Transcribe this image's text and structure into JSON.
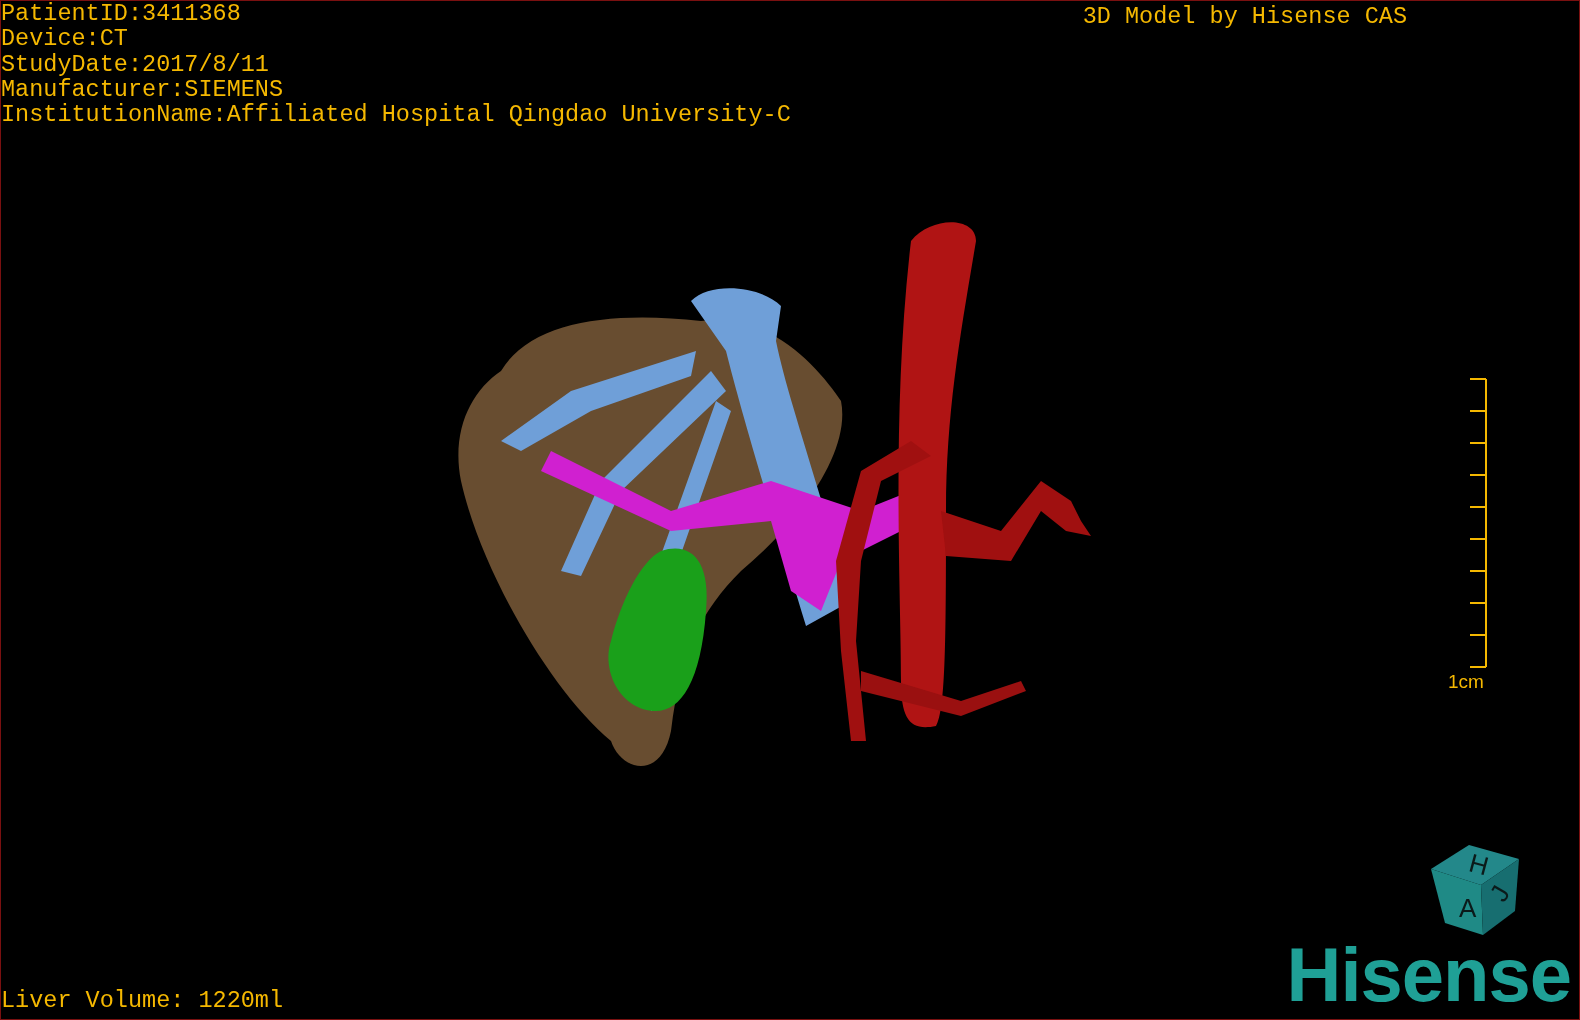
{
  "study_info": [
    "PatientID:3411368",
    "Device:CT",
    "StudyDate:2017/8/11",
    "Manufacturer:SIEMENS",
    "InstitutionName:Affiliated Hospital Qingdao University-C"
  ],
  "title": "3D Model by Hisense CAS",
  "scale_bar": {
    "label": "1cm"
  },
  "liver_volume": "Liver Volume: 1220ml",
  "orientation_cube": {
    "faces": [
      "H",
      "A",
      "J"
    ]
  },
  "logo": "Hisense"
}
